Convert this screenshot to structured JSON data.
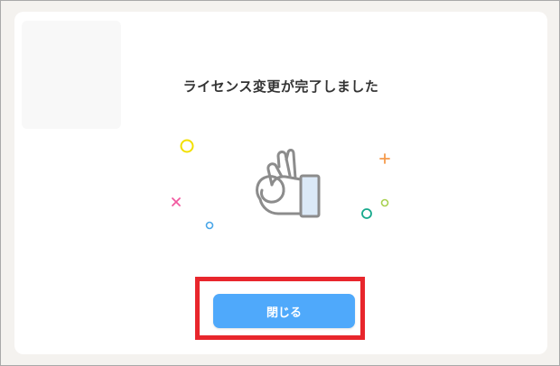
{
  "dialog": {
    "title": "ライセンス変更が完了しました",
    "close_label": "閉じる"
  },
  "colors": {
    "button": "#4fa9fb",
    "highlight": "#e8262c",
    "confetti_yellow": "#f2e000",
    "confetti_pink": "#f15aa0",
    "confetti_orange": "#f59a4b",
    "confetti_blue": "#49a6e8",
    "confetti_green": "#17a98c",
    "confetti_lime": "#a8d050"
  },
  "icons": {
    "illustration": "ok-hand-icon"
  }
}
